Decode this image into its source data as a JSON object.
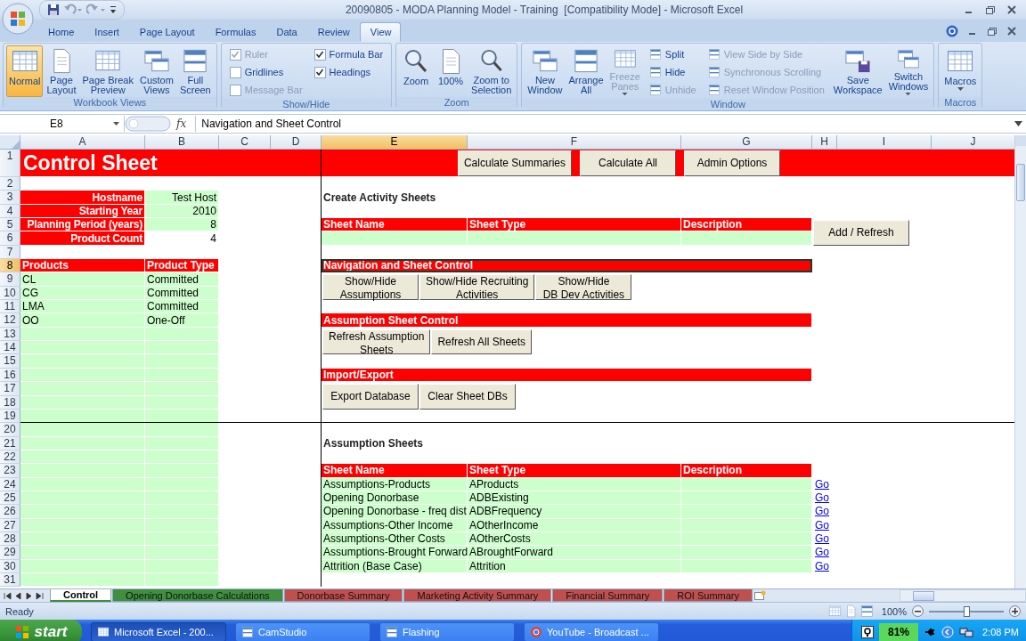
{
  "window": {
    "title": "20090805 - MODA Planning Model - Training  [Compatibility Mode] - Microsoft Excel"
  },
  "ribbon": {
    "tabs": [
      {
        "label": "Home",
        "selected": false
      },
      {
        "label": "Insert",
        "selected": false
      },
      {
        "label": "Page Layout",
        "selected": false
      },
      {
        "label": "Formulas",
        "selected": false
      },
      {
        "label": "Data",
        "selected": false
      },
      {
        "label": "Review",
        "selected": false
      },
      {
        "label": "View",
        "selected": true
      }
    ],
    "groups": [
      {
        "title": "Workbook Views",
        "items": [
          {
            "kind": "large",
            "label": "Normal",
            "selected": true
          },
          {
            "kind": "large",
            "label": "Page\nLayout",
            "selected": false
          },
          {
            "kind": "large",
            "label": "Page Break\nPreview",
            "selected": false
          },
          {
            "kind": "large",
            "label": "Custom\nViews",
            "selected": false
          },
          {
            "kind": "large",
            "label": "Full\nScreen",
            "selected": false
          }
        ]
      },
      {
        "title": "Show/Hide",
        "items": [
          {
            "kind": "check",
            "label": "Ruler",
            "checked": true,
            "disabled": true
          },
          {
            "kind": "check",
            "label": "Gridlines",
            "checked": false,
            "disabled": false
          },
          {
            "kind": "check",
            "label": "Message Bar",
            "checked": false,
            "disabled": true
          },
          {
            "kind": "check",
            "label": "Formula Bar",
            "checked": true,
            "disabled": false
          },
          {
            "kind": "check",
            "label": "Headings",
            "checked": true,
            "disabled": false
          }
        ]
      },
      {
        "title": "Zoom",
        "items": [
          {
            "kind": "large",
            "label": "Zoom"
          },
          {
            "kind": "large",
            "label": "100%"
          },
          {
            "kind": "large",
            "label": "Zoom to\nSelection"
          }
        ]
      },
      {
        "title": "Window",
        "items": [
          {
            "kind": "large",
            "label": "New\nWindow",
            "disabled": false
          },
          {
            "kind": "large",
            "label": "Arrange\nAll",
            "disabled": false
          },
          {
            "kind": "large",
            "label": "Freeze\nPanes",
            "disabled": true,
            "dropdown": true
          },
          {
            "kind": "small",
            "label": "Split",
            "disabled": false
          },
          {
            "kind": "small",
            "label": "Hide",
            "disabled": false
          },
          {
            "kind": "small",
            "label": "Unhide",
            "disabled": true
          },
          {
            "kind": "small",
            "label": "View Side by Side",
            "disabled": true
          },
          {
            "kind": "small",
            "label": "Synchronous Scrolling",
            "disabled": true
          },
          {
            "kind": "small",
            "label": "Reset Window Position",
            "disabled": true
          },
          {
            "kind": "large",
            "label": "Save\nWorkspace",
            "disabled": false
          },
          {
            "kind": "large",
            "label": "Switch\nWindows",
            "disabled": false,
            "dropdown": true
          }
        ]
      },
      {
        "title": "Macros",
        "items": [
          {
            "kind": "large",
            "label": "Macros",
            "dropdown": true
          }
        ]
      }
    ]
  },
  "formula_bar": {
    "name_box": "E8",
    "function_label": "fx",
    "formula": "Navigation and Sheet Control"
  },
  "sheet": {
    "columns": [
      {
        "label": "A",
        "selected": false
      },
      {
        "label": "B",
        "selected": false
      },
      {
        "label": "C",
        "selected": false
      },
      {
        "label": "D",
        "selected": false
      },
      {
        "label": "E",
        "selected": true
      },
      {
        "label": "F",
        "selected": false
      },
      {
        "label": "G",
        "selected": false
      },
      {
        "label": "H",
        "selected": false
      },
      {
        "label": "I",
        "selected": false
      },
      {
        "label": "J",
        "selected": false
      }
    ],
    "rows": [
      {
        "number": "1",
        "selected": false,
        "cells": {
          "A": {
            "kind": "title",
            "text": "Control Sheet",
            "merged": true
          },
          "E": {
            "kind": "red",
            "merged": true
          }
        },
        "buttons": {
          "E": [
            "Calculate Summaries",
            "Calculate All",
            "Admin Options"
          ]
        }
      },
      {
        "number": "2",
        "selected": false
      },
      {
        "number": "3",
        "selected": false,
        "cells": {
          "A": {
            "kind": "label",
            "text": "Hostname"
          },
          "B": {
            "kind": "value",
            "text": "Test Host"
          },
          "E": {
            "kind": "heading",
            "text": "Create Activity Sheets"
          }
        }
      },
      {
        "number": "4",
        "selected": false,
        "cells": {
          "A": {
            "kind": "label",
            "text": "Starting Year"
          },
          "B": {
            "kind": "value",
            "text": "2010"
          }
        }
      },
      {
        "number": "5",
        "selected": false,
        "cells": {
          "A": {
            "kind": "label",
            "text": "Planning Period (years)"
          },
          "B": {
            "kind": "value",
            "text": "8"
          },
          "E": {
            "kind": "header",
            "text": "Sheet Name"
          },
          "F": {
            "kind": "header",
            "text": "Sheet Type"
          },
          "G": {
            "kind": "header",
            "text": "Description"
          }
        },
        "buttons": {
          "H": [
            "Add / Refresh"
          ]
        }
      },
      {
        "number": "6",
        "selected": false,
        "cells": {
          "A": {
            "kind": "label",
            "text": "Product Count"
          },
          "B": {
            "kind": "plain-right",
            "text": "4"
          },
          "E": {
            "kind": "fill"
          },
          "F": {
            "kind": "fill"
          },
          "G": {
            "kind": "fill"
          }
        }
      },
      {
        "number": "7",
        "selected": false
      },
      {
        "number": "8",
        "selected": true,
        "cells": {
          "A": {
            "kind": "header",
            "text": "Products"
          },
          "B": {
            "kind": "header",
            "text": "Product Type"
          },
          "E": {
            "kind": "header",
            "text": "Navigation and Sheet Control",
            "merged": true,
            "active": true
          }
        }
      },
      {
        "number": "9",
        "selected": false,
        "cells": {
          "A": {
            "kind": "data",
            "text": "CL"
          },
          "B": {
            "kind": "data",
            "text": "Committed"
          }
        },
        "buttons": {
          "E": [
            "Show/Hide\nAssumptions",
            "Show/Hide Recruiting\nActivities",
            "Show/Hide\nDB Dev Activities"
          ]
        }
      },
      {
        "number": "10",
        "selected": false,
        "cells": {
          "A": {
            "kind": "data",
            "text": "CG"
          },
          "B": {
            "kind": "data",
            "text": "Committed"
          }
        }
      },
      {
        "number": "11",
        "selected": false,
        "cells": {
          "A": {
            "kind": "data",
            "text": "LMA"
          },
          "B": {
            "kind": "data",
            "text": "Committed"
          }
        }
      },
      {
        "number": "12",
        "selected": false,
        "cells": {
          "A": {
            "kind": "data",
            "text": "OO"
          },
          "B": {
            "kind": "data",
            "text": "One-Off"
          },
          "E": {
            "kind": "header",
            "text": "Assumption Sheet Control",
            "merged": true
          }
        }
      },
      {
        "number": "13",
        "selected": false,
        "cells": {
          "A": {
            "kind": "fill"
          },
          "B": {
            "kind": "fill"
          }
        },
        "buttons": {
          "E": [
            "Refresh Assumption\nSheets",
            "Refresh All Sheets"
          ]
        }
      },
      {
        "number": "14",
        "selected": false,
        "cells": {
          "A": {
            "kind": "fill"
          },
          "B": {
            "kind": "fill"
          }
        }
      },
      {
        "number": "15",
        "selected": false,
        "cells": {
          "A": {
            "kind": "fill"
          },
          "B": {
            "kind": "fill"
          }
        }
      },
      {
        "number": "16",
        "selected": false,
        "cells": {
          "A": {
            "kind": "fill"
          },
          "B": {
            "kind": "fill"
          },
          "E": {
            "kind": "header",
            "text": "Import/Export",
            "merged": true
          }
        }
      },
      {
        "number": "17",
        "selected": false,
        "cells": {
          "A": {
            "kind": "fill"
          },
          "B": {
            "kind": "fill"
          }
        },
        "buttons": {
          "E": [
            "Export Database",
            "Clear Sheet DBs"
          ]
        }
      },
      {
        "number": "18",
        "selected": false,
        "cells": {
          "A": {
            "kind": "fill"
          },
          "B": {
            "kind": "fill"
          }
        }
      },
      {
        "number": "19",
        "selected": false,
        "cells": {
          "A": {
            "kind": "fill"
          },
          "B": {
            "kind": "fill"
          }
        }
      },
      {
        "number": "20",
        "selected": false,
        "cells": {
          "A": {
            "kind": "fill"
          },
          "B": {
            "kind": "fill"
          }
        }
      },
      {
        "number": "21",
        "selected": false,
        "cells": {
          "A": {
            "kind": "fill"
          },
          "B": {
            "kind": "fill"
          },
          "E": {
            "kind": "heading",
            "text": "Assumption Sheets"
          }
        }
      },
      {
        "number": "22",
        "selected": false,
        "cells": {
          "A": {
            "kind": "fill"
          },
          "B": {
            "kind": "fill"
          }
        }
      },
      {
        "number": "23",
        "selected": false,
        "cells": {
          "A": {
            "kind": "fill"
          },
          "B": {
            "kind": "fill"
          },
          "E": {
            "kind": "header",
            "text": "Sheet Name"
          },
          "F": {
            "kind": "header",
            "text": "Sheet Type"
          },
          "G": {
            "kind": "header",
            "text": "Description"
          }
        }
      },
      {
        "number": "24",
        "selected": false,
        "cells": {
          "A": {
            "kind": "fill"
          },
          "B": {
            "kind": "fill"
          },
          "E": {
            "kind": "data",
            "text": "Assumptions-Products"
          },
          "F": {
            "kind": "data",
            "text": "AProducts"
          },
          "G": {
            "kind": "fill"
          },
          "H": {
            "kind": "link",
            "text": "Go"
          }
        }
      },
      {
        "number": "25",
        "selected": false,
        "cells": {
          "A": {
            "kind": "fill"
          },
          "B": {
            "kind": "fill"
          },
          "E": {
            "kind": "data",
            "text": "Opening Donorbase"
          },
          "F": {
            "kind": "data",
            "text": "ADBExisting"
          },
          "G": {
            "kind": "fill"
          },
          "H": {
            "kind": "link",
            "text": "Go"
          }
        }
      },
      {
        "number": "26",
        "selected": false,
        "cells": {
          "A": {
            "kind": "fill"
          },
          "B": {
            "kind": "fill"
          },
          "E": {
            "kind": "data",
            "text": "Opening Donorbase - freq dist"
          },
          "F": {
            "kind": "data",
            "text": "ADBFrequency"
          },
          "G": {
            "kind": "fill"
          },
          "H": {
            "kind": "link",
            "text": "Go"
          }
        }
      },
      {
        "number": "27",
        "selected": false,
        "cells": {
          "A": {
            "kind": "fill"
          },
          "B": {
            "kind": "fill"
          },
          "E": {
            "kind": "data",
            "text": "Assumptions-Other Income"
          },
          "F": {
            "kind": "data",
            "text": "AOtherIncome"
          },
          "G": {
            "kind": "fill"
          },
          "H": {
            "kind": "link",
            "text": "Go"
          }
        }
      },
      {
        "number": "28",
        "selected": false,
        "cells": {
          "A": {
            "kind": "fill"
          },
          "B": {
            "kind": "fill"
          },
          "E": {
            "kind": "data",
            "text": "Assumptions-Other Costs"
          },
          "F": {
            "kind": "data",
            "text": "AOtherCosts"
          },
          "G": {
            "kind": "fill"
          },
          "H": {
            "kind": "link",
            "text": "Go"
          }
        }
      },
      {
        "number": "29",
        "selected": false,
        "cells": {
          "A": {
            "kind": "fill"
          },
          "B": {
            "kind": "fill"
          },
          "E": {
            "kind": "data",
            "text": "Assumptions-Brought Forward"
          },
          "F": {
            "kind": "data",
            "text": "ABroughtForward"
          },
          "G": {
            "kind": "fill"
          },
          "H": {
            "kind": "link",
            "text": "Go"
          }
        }
      },
      {
        "number": "30",
        "selected": false,
        "cells": {
          "A": {
            "kind": "fill"
          },
          "B": {
            "kind": "fill"
          },
          "E": {
            "kind": "data",
            "text": "Attrition (Base Case)"
          },
          "F": {
            "kind": "data",
            "text": "Attrition"
          },
          "G": {
            "kind": "fill"
          },
          "H": {
            "kind": "link",
            "text": "Go"
          }
        }
      },
      {
        "number": "31",
        "selected": false,
        "cells": {
          "A": {
            "kind": "fill"
          },
          "B": {
            "kind": "fill"
          }
        }
      }
    ]
  },
  "sheet_tabs": [
    {
      "label": "Control",
      "selected": true
    },
    {
      "label": "Opening Donorbase Calculations",
      "selected": false,
      "color": "#3f8f3f"
    },
    {
      "label": "Donorbase Summary",
      "selected": false,
      "color": "#c0504d"
    },
    {
      "label": "Marketing Activity Summary",
      "selected": false,
      "color": "#c0504d"
    },
    {
      "label": "Financial Summary",
      "selected": false,
      "color": "#c0504d"
    },
    {
      "label": "ROI Summary",
      "selected": false,
      "color": "#c0504d"
    }
  ],
  "status_bar": {
    "text": "Ready",
    "zoom": "100%",
    "zoom_slider": {
      "level": 0.5
    }
  },
  "taskbar": {
    "start": "start",
    "tasks": [
      {
        "label": "Microsoft Excel - 200...",
        "selected": true
      },
      {
        "label": "CamStudio",
        "selected": false
      },
      {
        "label": "Flashing",
        "selected": false
      },
      {
        "label": "YouTube - Broadcast ...",
        "selected": false
      }
    ],
    "battery": "81%",
    "clock": "2:08 PM"
  }
}
